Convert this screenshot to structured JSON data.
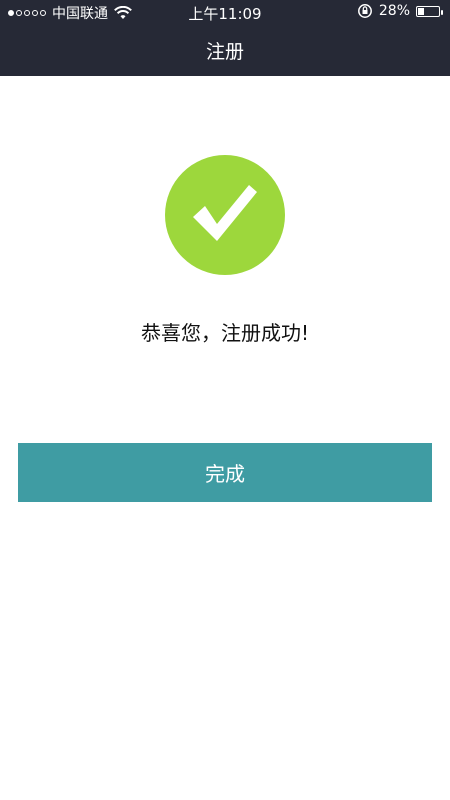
{
  "status_bar": {
    "carrier": "中国联通",
    "time": "上午11:09",
    "battery_percent_text": "28%",
    "battery_level": 0.28,
    "icons": [
      "signal-dots-icon",
      "wifi-icon",
      "orientation-lock-icon",
      "battery-icon"
    ]
  },
  "nav": {
    "title": "注册"
  },
  "main": {
    "success_icon": "checkmark-circle-icon",
    "message": "恭喜您，注册成功!",
    "done_label": "完成"
  },
  "colors": {
    "header_bg": "#262936",
    "success_green": "#9dd73c",
    "button_teal": "#3f9ca3",
    "text_dark": "#111111"
  }
}
